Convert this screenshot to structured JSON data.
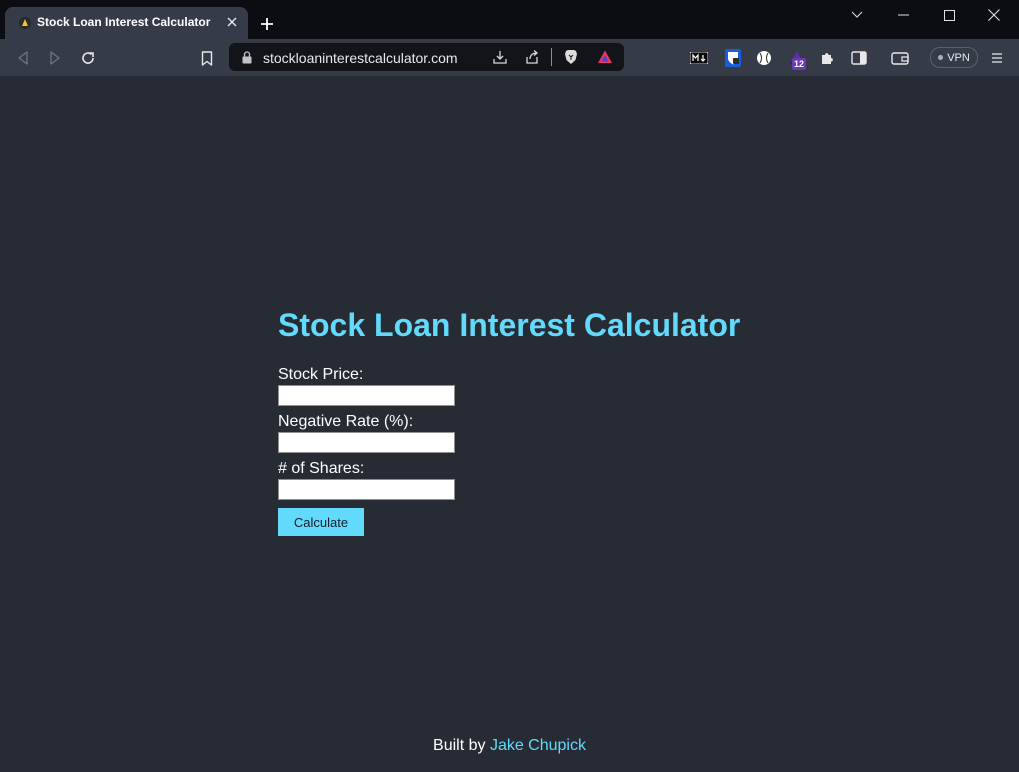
{
  "browser": {
    "tab": {
      "title": "Stock Loan Interest Calculator"
    },
    "address_bar": {
      "url": "stockloaninterestcalculator.com"
    },
    "extensions": {
      "badge_count": "12",
      "vpn_label": "VPN"
    }
  },
  "page": {
    "title": "Stock Loan Interest Calculator",
    "form": {
      "stock_price_label": "Stock Price:",
      "stock_price_value": "",
      "negative_rate_label": "Negative Rate (%):",
      "negative_rate_value": "",
      "shares_label": "# of Shares:",
      "shares_value": "",
      "calculate_label": "Calculate"
    },
    "footer": {
      "prefix": "Built by",
      "author_link": "Jake Chupick"
    }
  },
  "colors": {
    "accent": "#61dafb",
    "page_background": "#272b34",
    "toolbar": "#363c47",
    "titlebar": "#0c0d13"
  }
}
